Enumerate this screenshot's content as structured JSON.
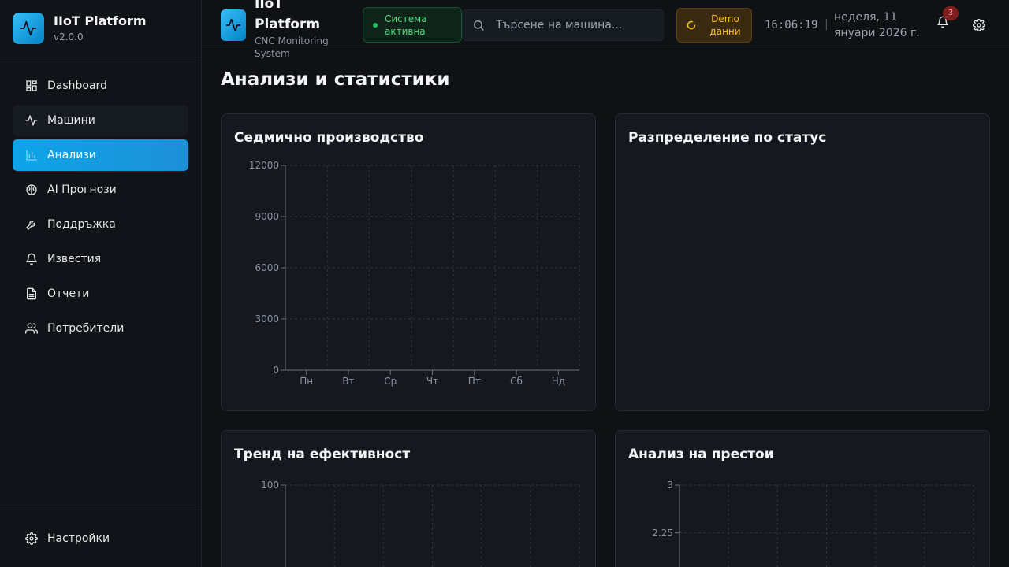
{
  "sidebar": {
    "brand_title": "IIoT Platform",
    "brand_version": "v2.0.0",
    "items": [
      {
        "label": "Dashboard",
        "icon": "grid-icon"
      },
      {
        "label": "Машини",
        "icon": "activity-icon"
      },
      {
        "label": "Анализи",
        "icon": "bar-chart-icon"
      },
      {
        "label": "AI Прогнози",
        "icon": "brain-icon"
      },
      {
        "label": "Поддръжка",
        "icon": "wrench-icon"
      },
      {
        "label": "Известия",
        "icon": "bell-icon"
      },
      {
        "label": "Отчети",
        "icon": "file-text-icon"
      },
      {
        "label": "Потребители",
        "icon": "users-icon"
      }
    ],
    "active_index": 2,
    "settings_label": "Настройки"
  },
  "header": {
    "title_line1": "IIoT",
    "title_line2": "Platform",
    "subtitle_line1": "CNC Monitoring",
    "subtitle_line2": "System",
    "status_line1": "Система",
    "status_line2": "активна",
    "search_placeholder": "Търсене на машина...",
    "demo_line1": "Demo",
    "demo_line2": "данни",
    "time": "16:06:19",
    "separator": "|",
    "date_line1": "неделя, 11",
    "date_line2": "януари 2026 г.",
    "notification_count": "3"
  },
  "colors": {
    "accent": "#0ea5e9",
    "status_green": "#22c55e",
    "demo_amber": "#fbbf24",
    "badge_red": "#7f1d1d"
  },
  "page": {
    "title": "Анализи и статистики"
  },
  "cards": {
    "weekly": "Седмично производство",
    "status_distribution": "Разпределение по статус",
    "efficiency_trend": "Тренд на ефективност",
    "downtime": "Анализ на престои"
  },
  "chart_data": [
    {
      "type": "bar",
      "title": "Седмично производство",
      "categories": [
        "Пн",
        "Вт",
        "Ср",
        "Чт",
        "Пт",
        "Сб",
        "Нд"
      ],
      "values": [],
      "y_ticks": [
        "0",
        "3000",
        "6000",
        "9000",
        "12000"
      ],
      "ylim": [
        0,
        12000
      ],
      "grid": true
    },
    {
      "type": "pie",
      "title": "Разпределение по статус",
      "values": []
    },
    {
      "type": "line",
      "title": "Тренд на ефективност",
      "y_ticks": [
        "100"
      ],
      "ylim": [
        0,
        100
      ],
      "values": [],
      "grid": true
    },
    {
      "type": "bar",
      "title": "Анализ на престои",
      "y_ticks": [
        "2.25",
        "3"
      ],
      "ylim": [
        0,
        3
      ],
      "values": [],
      "grid": true
    }
  ]
}
